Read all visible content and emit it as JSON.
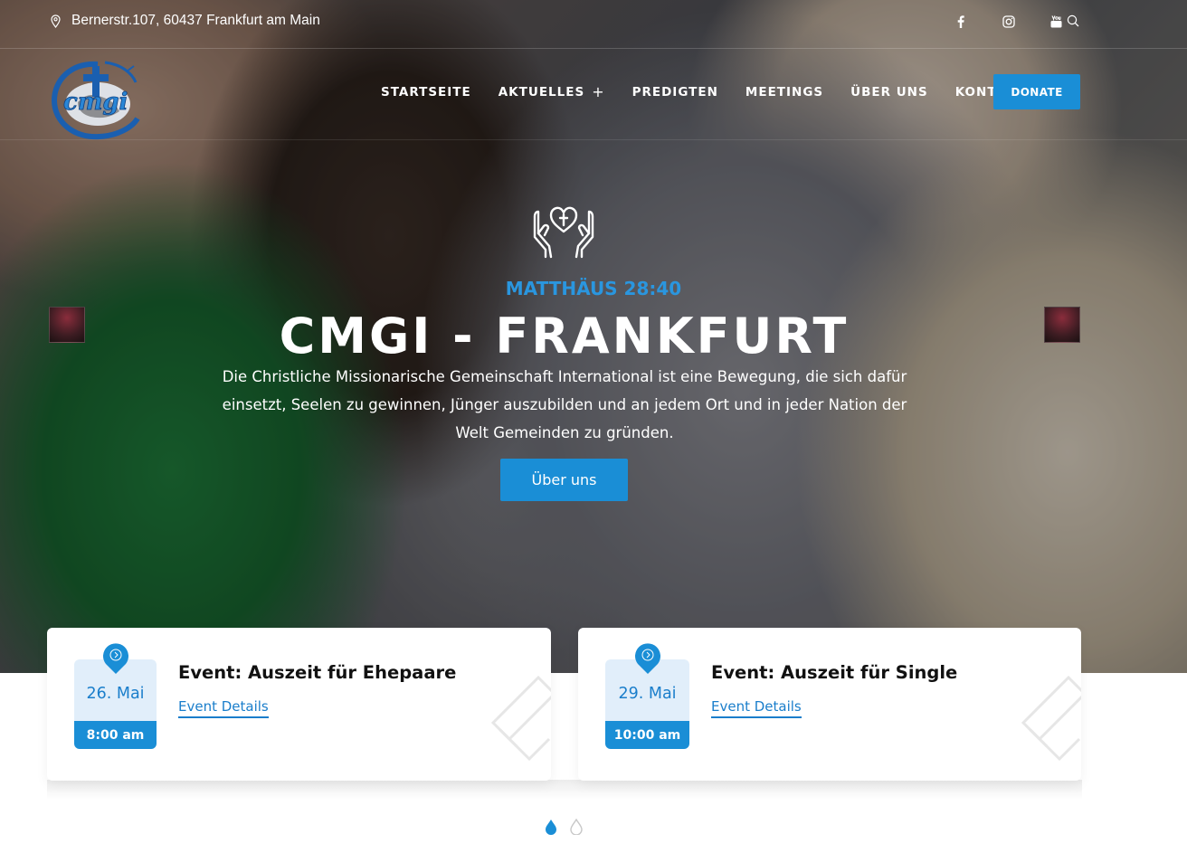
{
  "topbar": {
    "address": "Bernerstr.107, 60437 Frankfurt am Main",
    "socials": [
      "facebook-icon",
      "instagram-icon",
      "youtube-icon"
    ],
    "search_icon": "search-icon"
  },
  "nav": {
    "items": [
      {
        "label": "STARTSEITE"
      },
      {
        "label": "AKTUELLES",
        "has_submenu": true
      },
      {
        "label": "PREDIGTEN"
      },
      {
        "label": "MEETINGS"
      },
      {
        "label": "ÜBER UNS"
      },
      {
        "label": "KONTAKT"
      }
    ],
    "submenu_indicator": "+",
    "donate_label": "DONATE"
  },
  "slide": {
    "icon": "praying-hands-heart-icon",
    "subtitle": "MATTHÄUS 28:40",
    "title": "CMGI - FRANKFURT",
    "text": "Die Christliche Missionarische Gemeinschaft International ist eine Bewegung, die sich dafür einsetzt, Seelen zu gewinnen, Jünger auszubilden und an jedem Ort und in jeder Nation der Welt Gemeinden zu gründen.",
    "button_label": "Über uns"
  },
  "events": [
    {
      "date": "26. Mai",
      "time": "8:00 am",
      "title": "Event: Auszeit für Ehepaare",
      "link": "Event Details"
    },
    {
      "date": "29. Mai",
      "time": "10:00 am",
      "title": "Event: Auszeit für Single",
      "link": "Event Details"
    }
  ],
  "pagination": {
    "total": 2,
    "active": 1
  },
  "colors": {
    "accent": "#1a8ed6",
    "subtitle": "#2a96df",
    "date_bg": "#e1eefa"
  }
}
